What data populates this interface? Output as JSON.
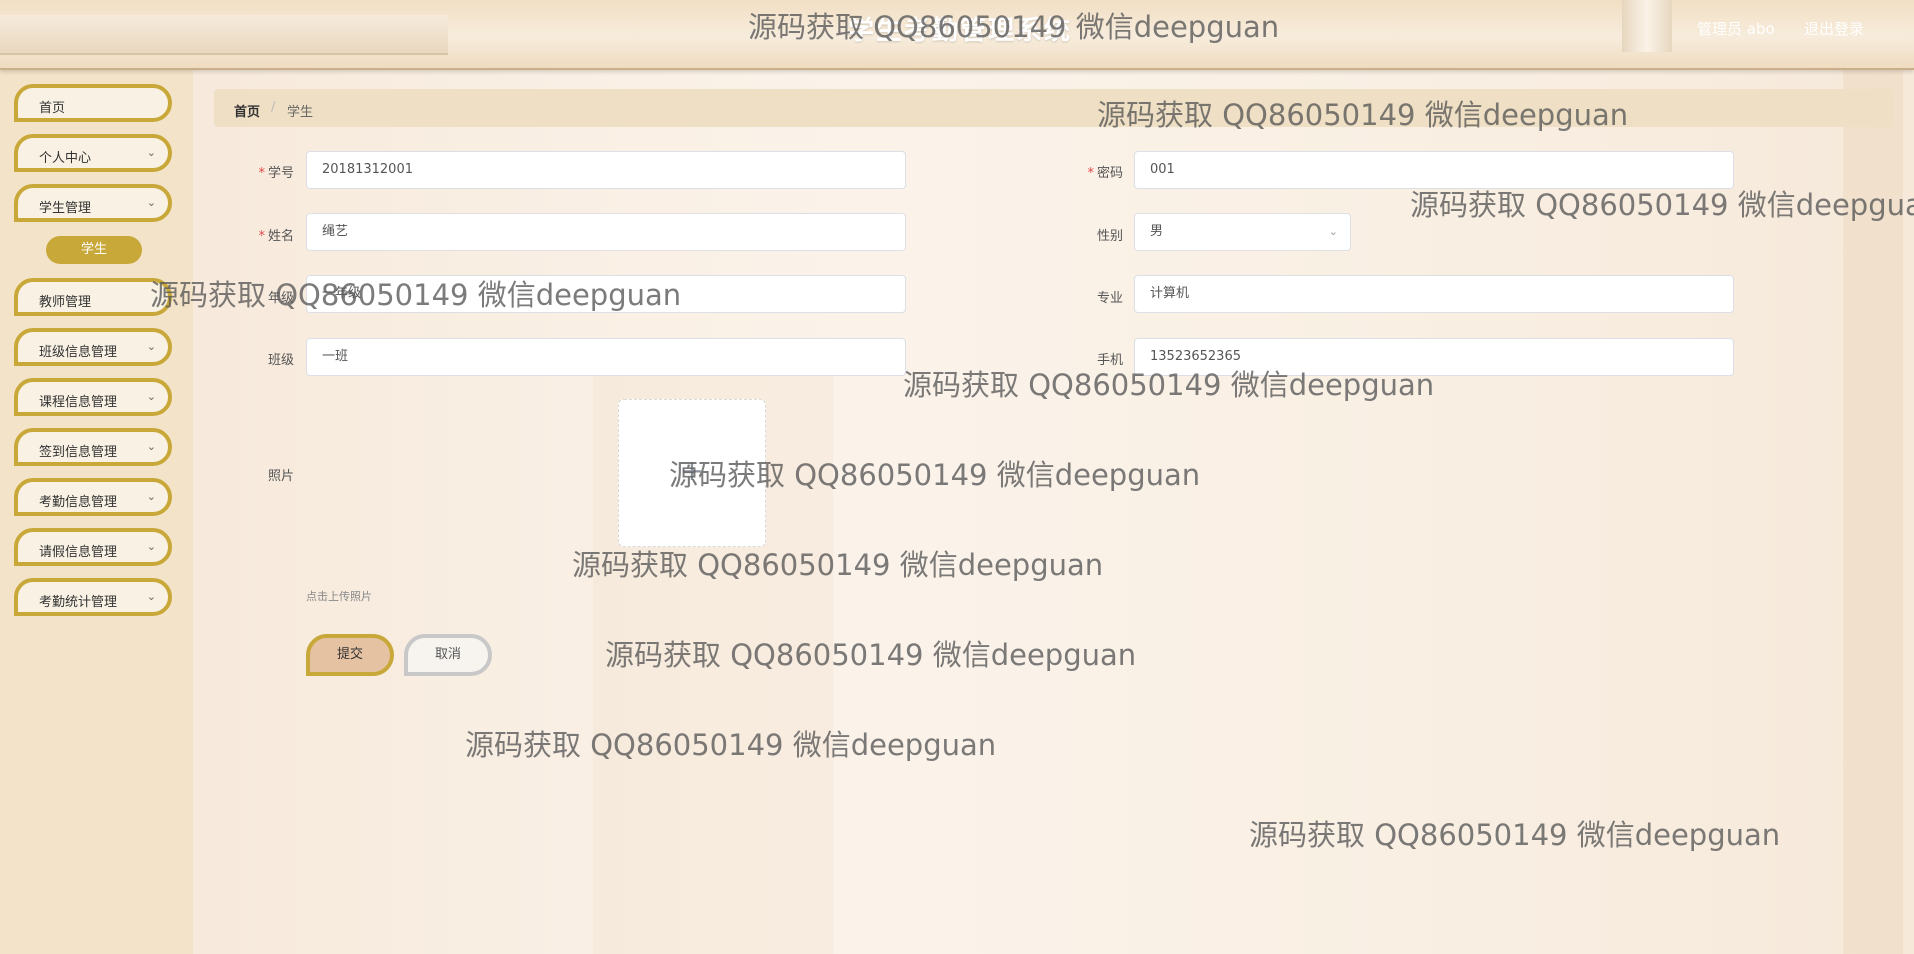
{
  "header": {
    "title": "学生考勤管理系统",
    "user": "管理员 abo",
    "logout": "退出登录"
  },
  "sidebar": {
    "items": [
      {
        "label": "首页",
        "has_chevron": false
      },
      {
        "label": "个人中心",
        "has_chevron": true
      },
      {
        "label": "学生管理",
        "has_chevron": true
      },
      {
        "label": "教师管理",
        "has_chevron": true
      },
      {
        "label": "班级信息管理",
        "has_chevron": true
      },
      {
        "label": "课程信息管理",
        "has_chevron": true
      },
      {
        "label": "签到信息管理",
        "has_chevron": true
      },
      {
        "label": "考勤信息管理",
        "has_chevron": true
      },
      {
        "label": "请假信息管理",
        "has_chevron": true
      },
      {
        "label": "考勤统计管理",
        "has_chevron": true
      }
    ],
    "submenu_active": "学生"
  },
  "breadcrumb": {
    "home": "首页",
    "separator": "/",
    "current": "学生"
  },
  "form": {
    "student_id": {
      "label": "学号",
      "value": "20181312001",
      "required": true
    },
    "password": {
      "label": "密码",
      "value": "001",
      "required": true
    },
    "name": {
      "label": "姓名",
      "value": "绳艺",
      "required": true
    },
    "gender": {
      "label": "性别",
      "value": "男"
    },
    "grade": {
      "label": "年级",
      "value": "一年级"
    },
    "major": {
      "label": "专业",
      "value": "计算机"
    },
    "class": {
      "label": "班级",
      "value": "一班"
    },
    "phone": {
      "label": "手机",
      "value": "13523652365"
    },
    "photo": {
      "label": "照片",
      "hint": "点击上传照片"
    }
  },
  "buttons": {
    "submit": "提交",
    "cancel": "取消"
  },
  "watermark": {
    "text": "源码获取 QQ86050149 微信deepguan"
  },
  "icons": {
    "chevron": "chevron-down-icon",
    "upload": "plus-icon"
  },
  "colors": {
    "accent": "#c9a83a",
    "sidebar_bg": "#f3e3c9",
    "breadcrumb_bg": "#efdfc4",
    "submit_bg": "#e5c2a2",
    "required": "#e04a4a"
  }
}
